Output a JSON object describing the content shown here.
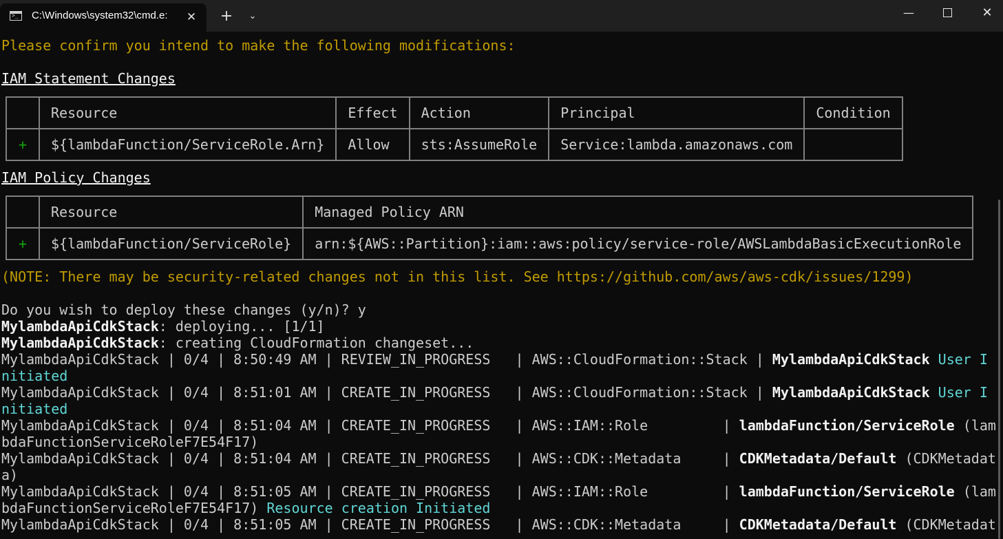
{
  "window": {
    "tab_title": "C:\\Windows\\system32\\cmd.e:",
    "tab_close": "✕",
    "new_tab": "+",
    "dropdown": "⌄",
    "minimize": "—",
    "close": "✕"
  },
  "terminal": {
    "confirm": "Please confirm you intend to make the following modifications:",
    "iam_statement_heading": "IAM Statement Changes",
    "statement_table": {
      "headers": [
        "",
        "Resource",
        "Effect",
        "Action",
        "Principal",
        "Condition"
      ],
      "row": [
        "+",
        "${lambdaFunction/ServiceRole.Arn}",
        "Allow",
        "sts:AssumeRole",
        "Service:lambda.amazonaws.com",
        ""
      ]
    },
    "iam_policy_heading": "IAM Policy Changes",
    "policy_table": {
      "headers": [
        "",
        "Resource",
        "Managed Policy ARN"
      ],
      "row": [
        "+",
        "${lambdaFunction/ServiceRole}",
        "arn:${AWS::Partition}:iam::aws:policy/service-role/AWSLambdaBasicExecutionRole"
      ]
    },
    "note": "(NOTE: There may be security-related changes not in this list. See https://github.com/aws/aws-cdk/issues/1299)",
    "prompt": "Do you wish to deploy these changes (y/n)? y",
    "stack": "MylambdaApiCdkStack",
    "deploying_suffix": ": deploying... [1/1]",
    "creating_suffix": ": creating CloudFormation changeset...",
    "events": [
      {
        "prefix": "MylambdaApiCdkStack | 0/4 | 8:50:49 AM | REVIEW_IN_PROGRESS   | AWS::CloudFormation::Stack | ",
        "logical": "MylambdaApiCdkStack",
        "rest1": "",
        "status1": " User I",
        "rest2": "",
        "status2": "nitiated"
      },
      {
        "prefix": "MylambdaApiCdkStack | 0/4 | 8:51:01 AM | CREATE_IN_PROGRESS   | AWS::CloudFormation::Stack | ",
        "logical": "MylambdaApiCdkStack",
        "rest1": "",
        "status1": " User I",
        "rest2": "",
        "status2": "nitiated"
      },
      {
        "prefix": "MylambdaApiCdkStack | 0/4 | 8:51:04 AM | CREATE_IN_PROGRESS   | AWS::IAM::Role         | ",
        "logical": "lambdaFunction/ServiceRole",
        "rest1": " (lam",
        "status1": "",
        "rest2": "bdaFunctionServiceRoleF7E54F17)",
        "status2": ""
      },
      {
        "prefix": "MylambdaApiCdkStack | 0/4 | 8:51:04 AM | CREATE_IN_PROGRESS   | AWS::CDK::Metadata     | ",
        "logical": "CDKMetadata/Default",
        "rest1": " (CDKMetadat",
        "status1": "",
        "rest2": "a)",
        "status2": ""
      },
      {
        "prefix": "MylambdaApiCdkStack | 0/4 | 8:51:05 AM | CREATE_IN_PROGRESS   | AWS::IAM::Role         | ",
        "logical": "lambdaFunction/ServiceRole",
        "rest1": " (lam",
        "status1": "",
        "rest2": "bdaFunctionServiceRoleF7E54F17)",
        "status2": " Resource creation Initiated"
      },
      {
        "prefix": "MylambdaApiCdkStack | 0/4 | 8:51:05 AM | CREATE_IN_PROGRESS   | AWS::CDK::Metadata     | ",
        "logical": "CDKMetadata/Default",
        "rest1": " (CDKMetadat",
        "status1": "",
        "rest2": "",
        "status2": ""
      }
    ]
  },
  "colors": {
    "background": "#0c0c0c",
    "yellow": "#c19c00",
    "green": "#13a10e",
    "cyan": "#61d6d6",
    "text": "#cccccc"
  }
}
